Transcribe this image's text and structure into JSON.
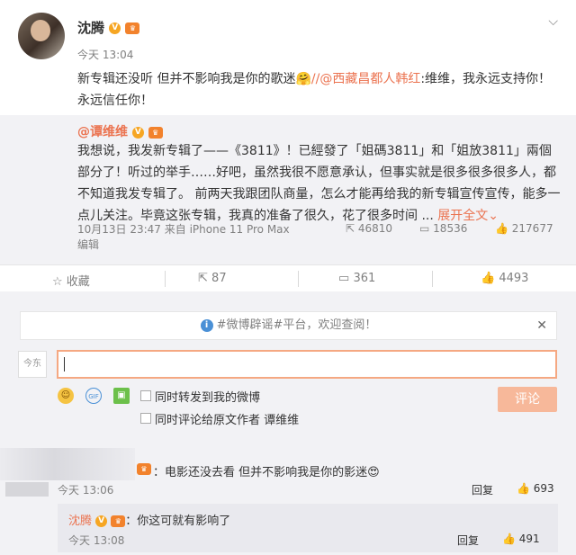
{
  "post": {
    "author": "沈腾",
    "time": "今天 13:04",
    "text_before": "新专辑还没听 但并不影响我是你的歌迷",
    "emoji": "🤗",
    "text_sep": "//",
    "mention": "@西藏昌都人韩红",
    "text_after": ":维维，我永远支持你！永远信任你！"
  },
  "quoted": {
    "author": "@谭维维",
    "text": "我想说，我发新专辑了——《3811》！已經發了「姐碼3811」和「姐放3811」兩個部分了！听过的举手……好吧，虽然我很不愿意承认，但事实就是很多很多很多人，都不知道我发专辑了。 前两天我跟团队商量，怎么才能再给我的新专辑宣传宣传，能多一点儿关注。毕竟这张专辑，我真的准备了很久，花了很多时间 ...",
    "expand": "展开全文",
    "expand_icon": "chevron-down",
    "meta": "10月13日 23:47 来自 iPhone 11 Pro Max",
    "edited": "编辑",
    "reposts": "46810",
    "comments": "18536",
    "likes": "217677"
  },
  "actions": {
    "collect": "收藏",
    "repost": "87",
    "comment": "361",
    "like": "4493"
  },
  "notice": {
    "text": "#微博辟谣#平台，欢迎查阅！"
  },
  "composer": {
    "value": "",
    "opt_repost": "同时转发到我的微博",
    "opt_comment_prefix": "同时评论给原文作者 ",
    "opt_comment_author": "谭维维",
    "submit": "评论",
    "mini_avatar": "今东"
  },
  "comments": [
    {
      "text": "：电影还没去看 但并不影响我是你的影迷",
      "emoji": "😍",
      "time": "今天 13:06",
      "reply": "回复",
      "likes": "693"
    }
  ],
  "subreply": {
    "author": "沈腾",
    "text": "：你这可就有影响了",
    "time": "今天 13:08",
    "reply": "回复",
    "likes": "491"
  },
  "colors": {
    "accent": "#eb7350",
    "link": "#eb7350",
    "vip": "#f6a623"
  }
}
